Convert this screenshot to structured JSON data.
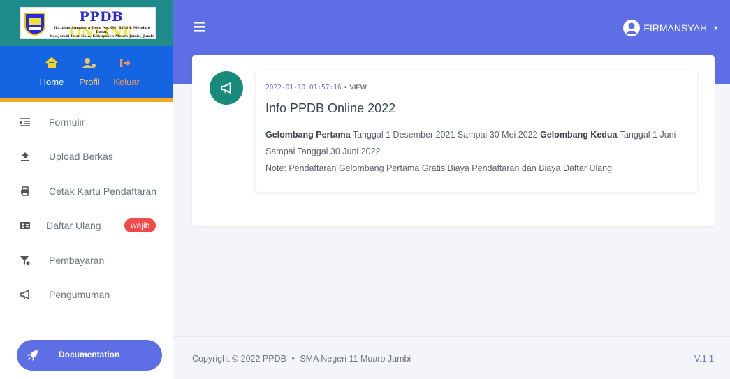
{
  "brand": {
    "title_part1": "PPDB",
    "title_part2": "ONLINE",
    "address_line1": "Jl.Lintas Sumatera Desu No.KM, RW.16, Mendalo Darat,",
    "address_line2": "Kec.Jambi Luar Kota, Kabupaten Muaro Jambi, Jambi"
  },
  "topnav": {
    "home": "Home",
    "profil": "Profil",
    "keluar": "Keluar"
  },
  "sidebar": {
    "items": [
      {
        "label": "Formulir",
        "icon": "list-indent-icon"
      },
      {
        "label": "Upload Berkas",
        "icon": "upload-icon"
      },
      {
        "label": "Cetak Kartu Pendaftaran",
        "icon": "print-icon"
      },
      {
        "label": "Daftar Ulang",
        "icon": "id-card-icon",
        "badge": "wajib"
      },
      {
        "label": "Pembayaran",
        "icon": "money-filter-icon"
      },
      {
        "label": "Pengumuman",
        "icon": "megaphone-icon"
      }
    ],
    "doc_button": "Documentation"
  },
  "header": {
    "user_name": "FIRMANSYAH"
  },
  "post": {
    "datetime": "2022-01-10 01:57:16",
    "view_label": "VIEW",
    "title": "Info PPDB Online 2022",
    "phase1_label": "Gelombang Pertama",
    "phase1_text": "Tanggal 1 Desember 2021 Sampai 30 Mei 2022",
    "phase2_label": "Gelombang Kedua",
    "phase2_text": "Tanggal 1 Juni Sampai Tanggal 30 Juni 2022",
    "note": "Note: Pendaftaran Gelombang Pertama Gratis Biaya Pendaftaran dan Biaya Daftar Ulang"
  },
  "footer": {
    "copyright": "Copyright © 2022 PPDB",
    "school": "SMA Negeri 11 Muaro Jambi",
    "version": "V.1.1"
  },
  "colors": {
    "primary": "#5e6fe6",
    "brand_teal": "#1f8a8a",
    "nav_blue": "#1565e3",
    "accent_orange": "#f5a623",
    "badge_red": "#f24a4a",
    "timeline_teal": "#178a7a"
  }
}
